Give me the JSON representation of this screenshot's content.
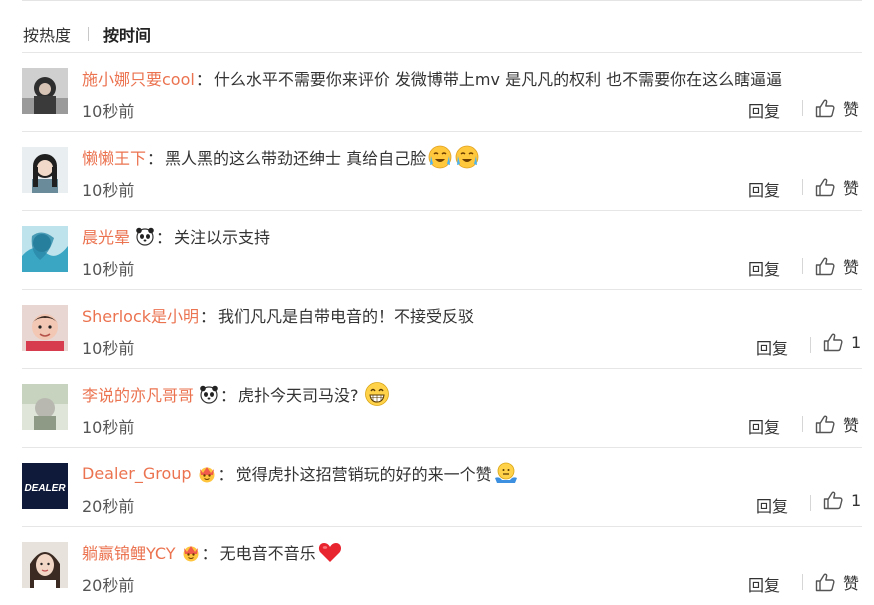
{
  "tabs": {
    "hot": "按热度",
    "time": "按时间"
  },
  "reply_label": "回复",
  "comments": [
    {
      "user": "施小娜只要cool",
      "text": "什么水平不需要你来评价 发微博带上mv 是凡凡的权利 也不需要你在这么瞎逼逼",
      "time": "10秒前",
      "likes": "赞"
    },
    {
      "user": "懒懒王下",
      "text": "黑人黑的这么带劲还绅士 真给自己脸",
      "time": "10秒前",
      "likes": "赞"
    },
    {
      "user": "晨光晕",
      "text": "关注以示支持",
      "time": "10秒前",
      "likes": "赞"
    },
    {
      "user": "Sherlock是小明",
      "text": "我们凡凡是自带电音的！不接受反驳",
      "time": "10秒前",
      "likes": "1"
    },
    {
      "user": "李说的亦凡哥哥",
      "text": "虎扑今天司马没?",
      "time": "10秒前",
      "likes": "赞"
    },
    {
      "user": "Dealer_Group",
      "text": "觉得虎扑这招营销玩的好的来一个赞",
      "time": "20秒前",
      "likes": "1",
      "avatar_text": "DEALER"
    },
    {
      "user": "躺赢锦鲤YCY",
      "text": "无电音不音乐",
      "time": "20秒前",
      "likes": "赞"
    }
  ],
  "colors": {
    "username": "#eb7350",
    "text": "#333333",
    "divider": "#e6e6e6"
  },
  "icons": [
    "thumbs-up-icon",
    "panda-badge-icon",
    "crown-badge-icon",
    "crying-laugh-emoji-icon",
    "grin-emoji-icon",
    "shrug-emoji-icon",
    "red-heart-emoji-icon"
  ]
}
